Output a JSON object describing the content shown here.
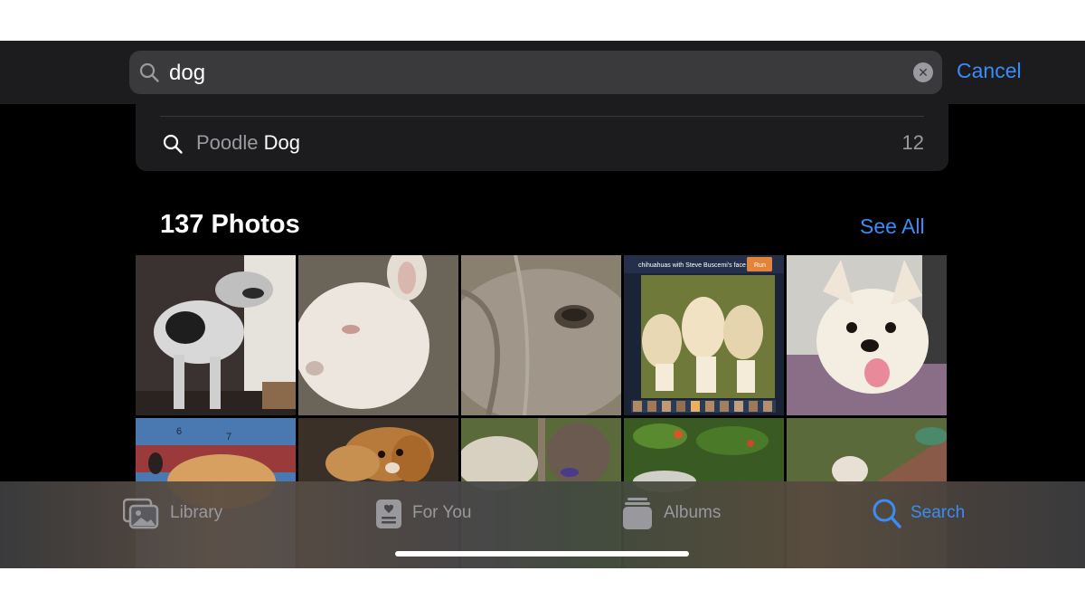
{
  "search": {
    "query": "dog",
    "cancel_label": "Cancel"
  },
  "suggestion": {
    "prefix": "Poodle ",
    "match": "Dog",
    "count": "12"
  },
  "results": {
    "title": "137 Photos",
    "see_all_label": "See All",
    "thumb_caption": "chihuahuas with Steve Buscemi's face",
    "thumb_run_label": "Run"
  },
  "tabs": [
    {
      "label": "Library",
      "icon": "photo-library-icon",
      "active": false
    },
    {
      "label": "For You",
      "icon": "for-you-icon",
      "active": false
    },
    {
      "label": "Albums",
      "icon": "albums-stack-icon",
      "active": false
    },
    {
      "label": "Search",
      "icon": "search-icon",
      "active": true
    }
  ],
  "colors": {
    "accent": "#3b8cf5",
    "background": "#000000",
    "panel": "#1c1c1e",
    "field": "#3a3a3c",
    "secondary_text": "#9a9aa0"
  }
}
